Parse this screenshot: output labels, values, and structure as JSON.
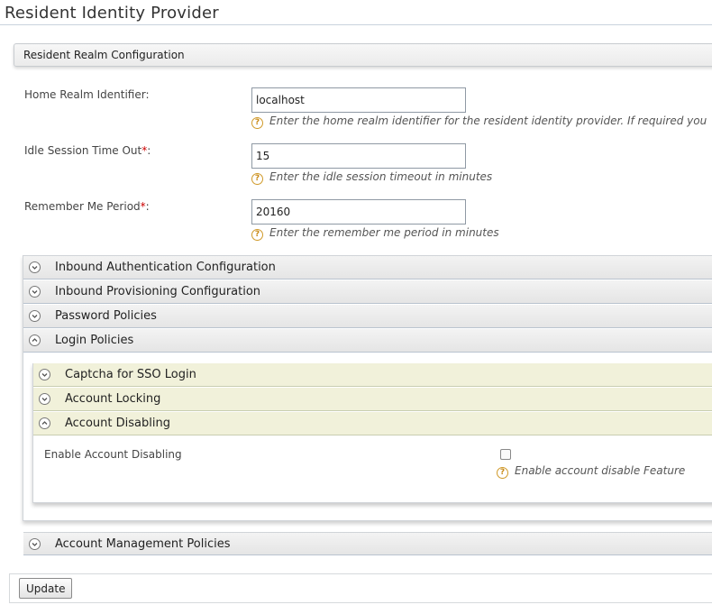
{
  "page": {
    "title": "Resident Identity Provider"
  },
  "realm_section": {
    "title": "Resident Realm Configuration"
  },
  "fields": {
    "home_realm": {
      "label": "Home Realm Identifier:",
      "value": "localhost",
      "help": "Enter the home realm identifier for the resident identity provider. If required you"
    },
    "idle_timeout": {
      "label": "Idle Session Time Out",
      "required": "*",
      "suffix": ":",
      "value": "15",
      "help": "Enter the idle session timeout in minutes"
    },
    "remember_me": {
      "label": "Remember Me Period",
      "required": "*",
      "suffix": ":",
      "value": "20160",
      "help": "Enter the remember me period in minutes"
    }
  },
  "sections": {
    "inbound_auth": "Inbound Authentication Configuration",
    "inbound_prov": "Inbound Provisioning Configuration",
    "password_policies": "Password Policies",
    "login_policies": "Login Policies",
    "account_mgmt": "Account Management Policies"
  },
  "login_policies": {
    "captcha": "Captcha for SSO Login",
    "account_locking": "Account Locking",
    "account_disabling": "Account Disabling",
    "enable_disabling_label": "Enable Account Disabling",
    "enable_disabling_checked": false,
    "enable_disabling_help": "Enable account disable Feature"
  },
  "actions": {
    "update": "Update"
  },
  "icons": {
    "help": "question-circle-icon",
    "collapsed": "chevron-down-circle-icon",
    "expanded": "chevron-up-circle-icon"
  },
  "colors": {
    "required": "#cc0000",
    "help_icon": "#c98a16",
    "subsection_bg": "#f1f1da"
  }
}
